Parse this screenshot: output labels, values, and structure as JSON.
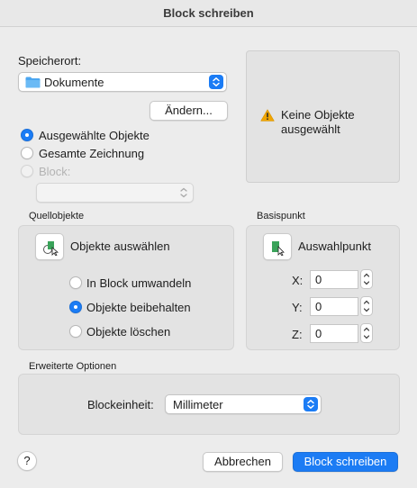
{
  "window": {
    "title": "Block schreiben"
  },
  "location": {
    "label": "Speicherort:",
    "selected": "Dokumente",
    "change_button": "Ändern..."
  },
  "source": {
    "options": [
      "Ausgewählte Objekte",
      "Gesamte Zeichnung",
      "Block:"
    ],
    "selected_index": 0,
    "block_popup_value": ""
  },
  "preview": {
    "message": "Keine Objekte ausgewählt",
    "icon": "warning-icon"
  },
  "source_objects": {
    "title": "Quellobjekte",
    "select_button": "Objekte auswählen",
    "options": [
      "In Block umwandeln",
      "Objekte beibehalten",
      "Objekte löschen"
    ],
    "selected_index": 1
  },
  "base_point": {
    "title": "Basispunkt",
    "pick_button": "Auswahlpunkt",
    "x_label": "X:",
    "x_value": "0",
    "y_label": "Y:",
    "y_value": "0",
    "z_label": "Z:",
    "z_value": "0"
  },
  "advanced": {
    "title": "Erweiterte Optionen",
    "unit_label": "Blockeinheit:",
    "unit_value": "Millimeter"
  },
  "footer": {
    "help": "?",
    "cancel": "Abbrechen",
    "confirm": "Block schreiben"
  },
  "colors": {
    "accent": "#1b7cf5",
    "folder": "#4ba6f0",
    "warning": "#f0a500",
    "pick_green": "#3aa35a"
  }
}
